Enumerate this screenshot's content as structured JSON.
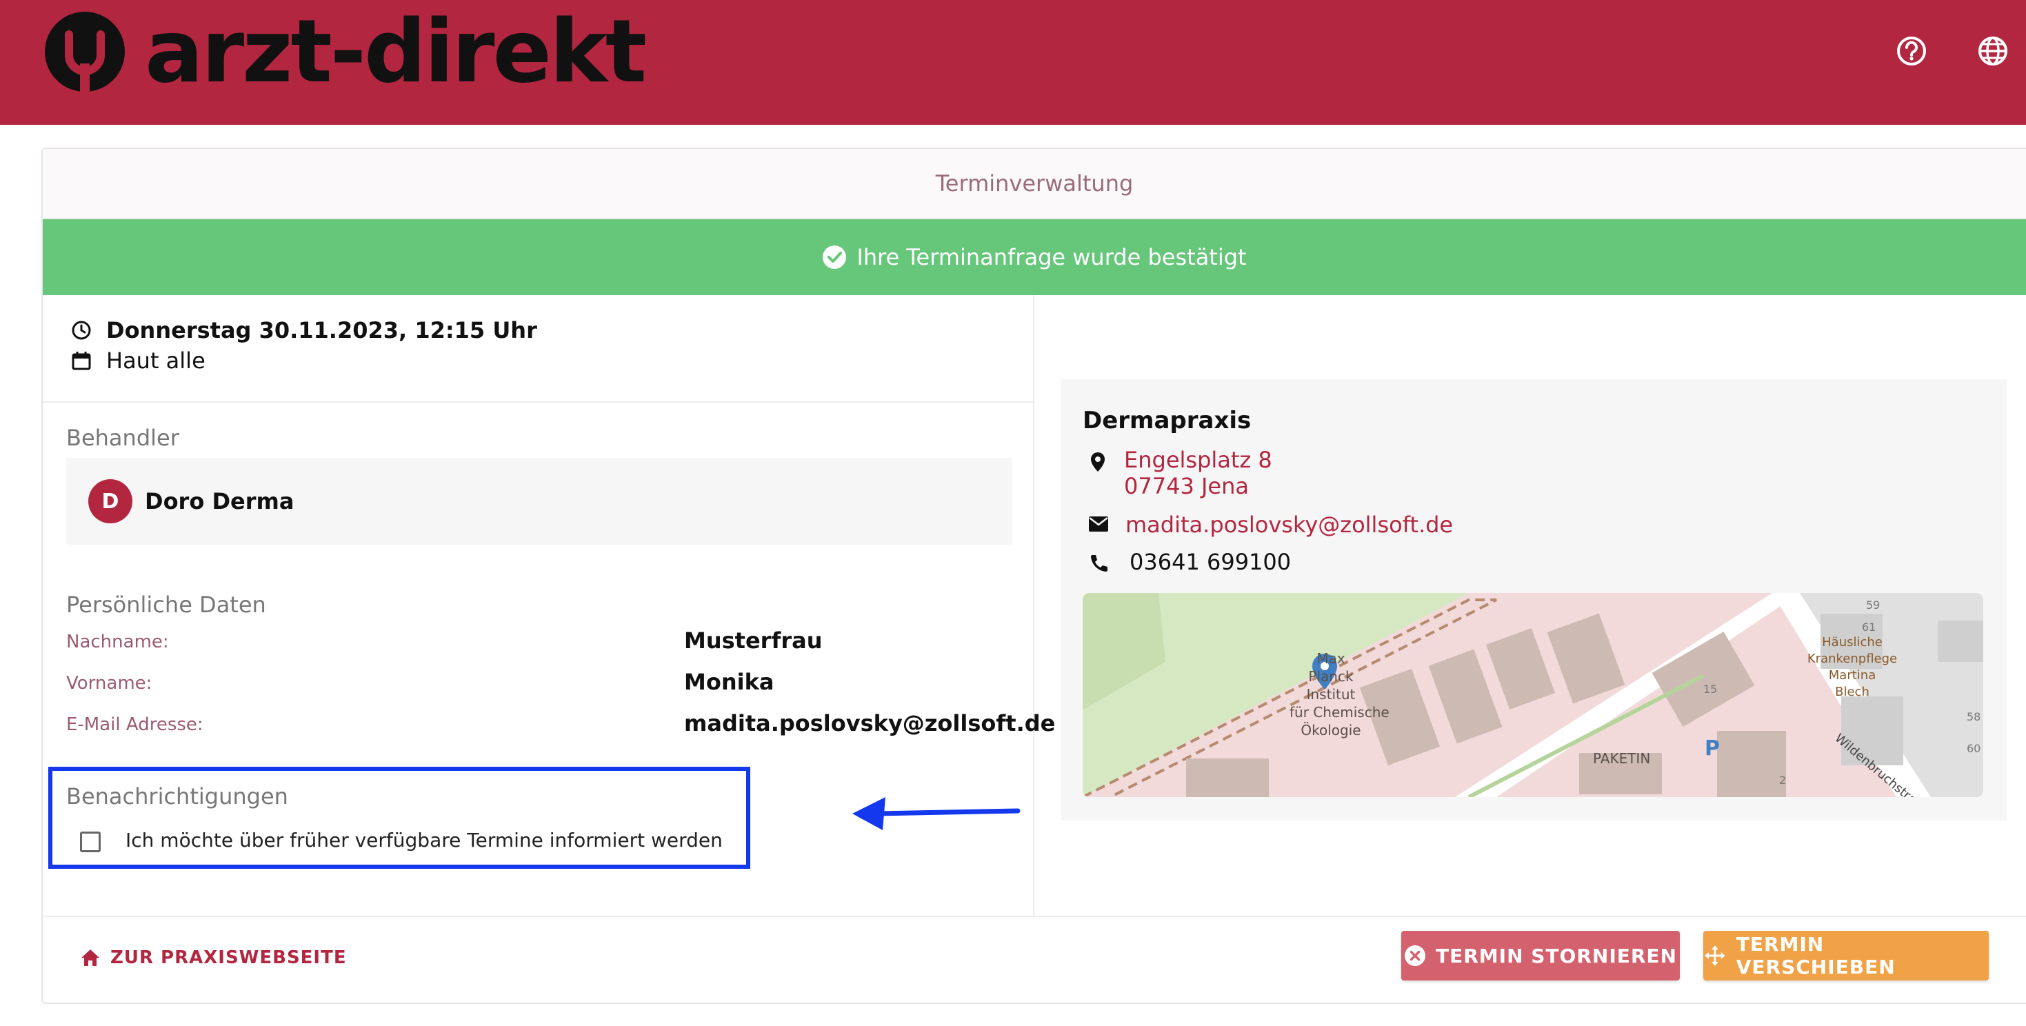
{
  "brand": {
    "name": "arzt-direkt",
    "primary_color": "#b32640"
  },
  "header": {
    "help_icon": "help-circle-icon",
    "language_icon": "globe-icon"
  },
  "card": {
    "title": "Terminverwaltung",
    "banner": "Ihre Terminanfrage wurde bestätigt",
    "banner_color": "#66c67a"
  },
  "appointment": {
    "datetime": "Donnerstag 30.11.2023, 12:15 Uhr",
    "type": "Haut alle"
  },
  "treater": {
    "section_title": "Behandler",
    "avatar_letter": "D",
    "name": "Doro Derma"
  },
  "personal": {
    "section_title": "Persönliche Daten",
    "fields": [
      {
        "label": "Nachname:",
        "value": "Musterfrau"
      },
      {
        "label": "Vorname:",
        "value": "Monika"
      },
      {
        "label": "E-Mail Adresse:",
        "value": "madita.poslovsky@zollsoft.de"
      }
    ]
  },
  "notifications": {
    "section_title": "Benachrichtigungen",
    "checkbox_label": "Ich möchte über früher verfügbare Termine informiert werden",
    "checked": false,
    "highlight_color": "#1338ee"
  },
  "practice": {
    "name": "Dermapraxis",
    "street": "Engelsplatz 8",
    "city": "07743 Jena",
    "email": "madita.poslovsky@zollsoft.de",
    "phone": "03641 699100",
    "map_labels": {
      "institute": [
        "Max",
        "Planck",
        "Institut",
        "für Chemische",
        "Ökologie"
      ],
      "care": [
        "Häusliche",
        "Krankenpflege",
        "Martina",
        "Blech"
      ],
      "paketin": "PAKETIN",
      "street": "Wildenbruchstraße",
      "numbers": [
        "59",
        "61",
        "15",
        "2",
        "58",
        "60"
      ],
      "parking": "P"
    }
  },
  "footer": {
    "website_link": "ZUR PRAXISWEBSEITE",
    "cancel_button": "TERMIN STORNIEREN",
    "move_button": "TERMIN VERSCHIEBEN",
    "cancel_color": "#d4616e",
    "move_color": "#f1a246"
  }
}
